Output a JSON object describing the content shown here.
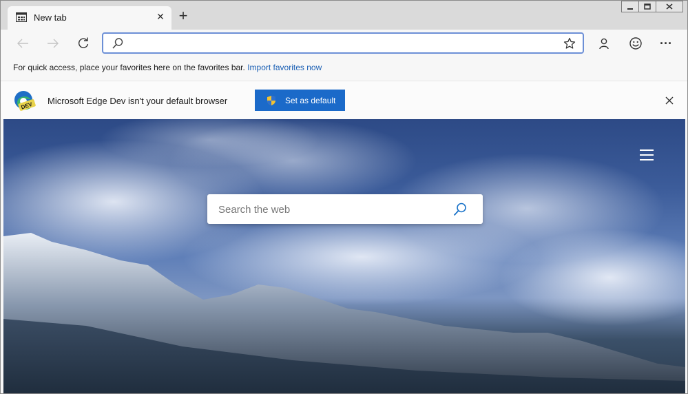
{
  "tab": {
    "title": "New tab",
    "close_glyph": "✕"
  },
  "new_tab_glyph": "+",
  "window_controls": {
    "minimize": "▁",
    "maximize": "▢",
    "close": "✕"
  },
  "toolbar": {
    "back_icon": "back-arrow-icon",
    "forward_icon": "forward-arrow-icon",
    "refresh_icon": "refresh-icon",
    "address_value": "",
    "profile_icon": "person-icon",
    "feedback_icon": "smiley-icon",
    "more_glyph": "···"
  },
  "favorites_bar": {
    "text": "For quick access, place your favorites here on the favorites bar.",
    "link": "Import favorites now"
  },
  "notice": {
    "message": "Microsoft Edge Dev isn't your default browser",
    "button": "Set as default",
    "logo_text": "DEV"
  },
  "newtab": {
    "search_placeholder": "Search the web"
  },
  "colors": {
    "accent": "#1b6ac9",
    "link": "#1a5fb4",
    "address_border": "#6c8fd6"
  }
}
